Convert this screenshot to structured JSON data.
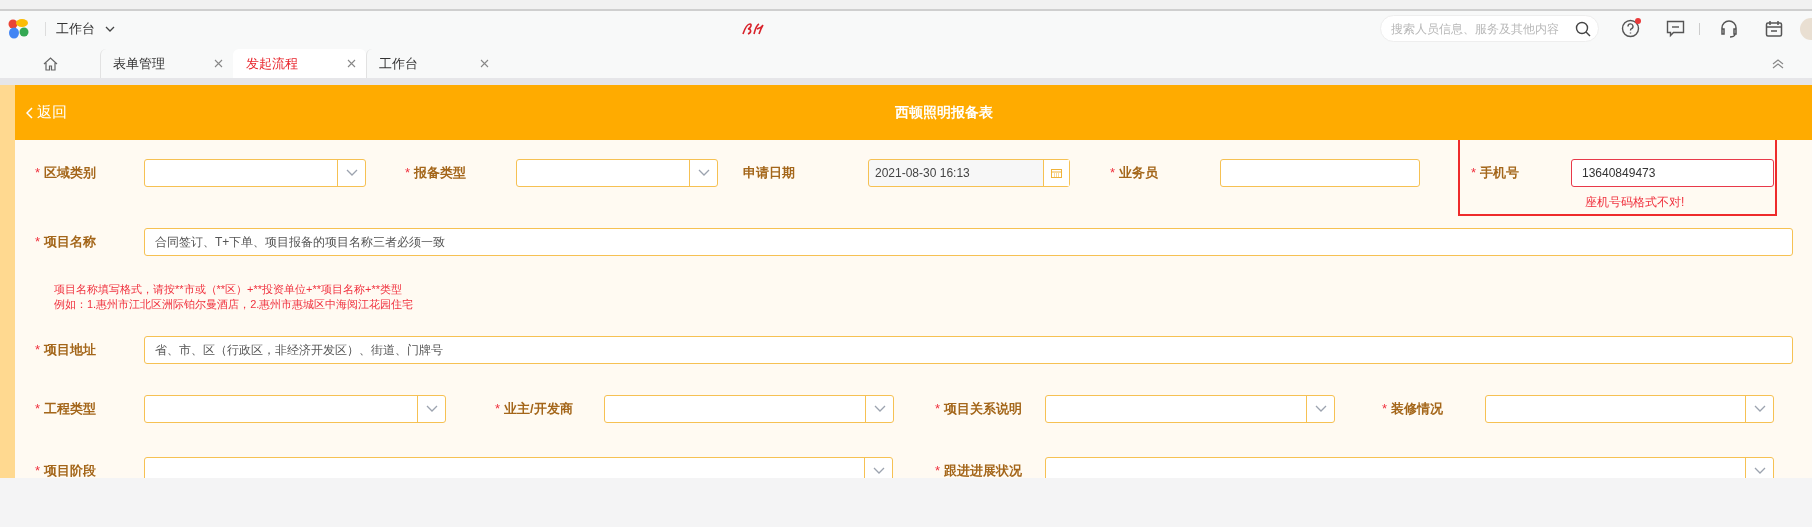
{
  "app_bar": {
    "workspace": "工作台",
    "search": {
      "placeholder": "搜索人员信息、服务及其他内容"
    },
    "help_badge": true
  },
  "tabs": [
    {
      "label": "表单管理",
      "selected": false
    },
    {
      "label": "发起流程",
      "selected": true
    },
    {
      "label": "工作台",
      "selected": false
    }
  ],
  "form": {
    "back": "返回",
    "title": "西顿照明报备表",
    "rows": [
      [
        {
          "kind": "select",
          "label": "区域类别",
          "required_mark": "*"
        },
        {
          "kind": "select",
          "label": "报备类型",
          "required_mark": "*"
        },
        {
          "kind": "date",
          "label": "申请日期",
          "value": "2021-08-30 16:13"
        },
        {
          "kind": "text",
          "label": "业务员",
          "required_mark": "*"
        },
        {
          "kind": "text",
          "label": "手机号",
          "required_mark": "*",
          "value": "13640849473",
          "error": "座机号码格式不对!",
          "highlighted": true
        }
      ],
      [
        {
          "kind": "text",
          "label": "项目名称",
          "required_mark": "*",
          "placeholder": "合同签订、T+下单、项目报备的项目名称三者必须一致"
        }
      ],
      [
        {
          "kind": "note",
          "lines": [
            "项目名称填写格式，请按**市或（**区）+**投资单位+**项目名称+**类型",
            "例如：1.惠州市江北区洲际铂尔曼酒店，2.惠州市惠城区中海阅江花园住宅"
          ]
        }
      ],
      [
        {
          "kind": "text",
          "label": "项目地址",
          "required_mark": "*",
          "placeholder": "省、市、区（行政区，非经济开发区）、街道、门牌号"
        }
      ],
      [
        {
          "kind": "select",
          "label": "工程类型",
          "required_mark": "*"
        },
        {
          "kind": "select",
          "label": "业主/开发商",
          "required_mark": "*"
        },
        {
          "kind": "select",
          "label": "项目关系说明",
          "required_mark": "*"
        },
        {
          "kind": "select",
          "label": "装修情况",
          "required_mark": "*"
        }
      ],
      [
        {
          "kind": "select",
          "label": "项目阶段",
          "required_mark": "*"
        },
        {
          "kind": "select",
          "label": "跟进进展状况",
          "required_mark": "*"
        }
      ]
    ]
  }
}
